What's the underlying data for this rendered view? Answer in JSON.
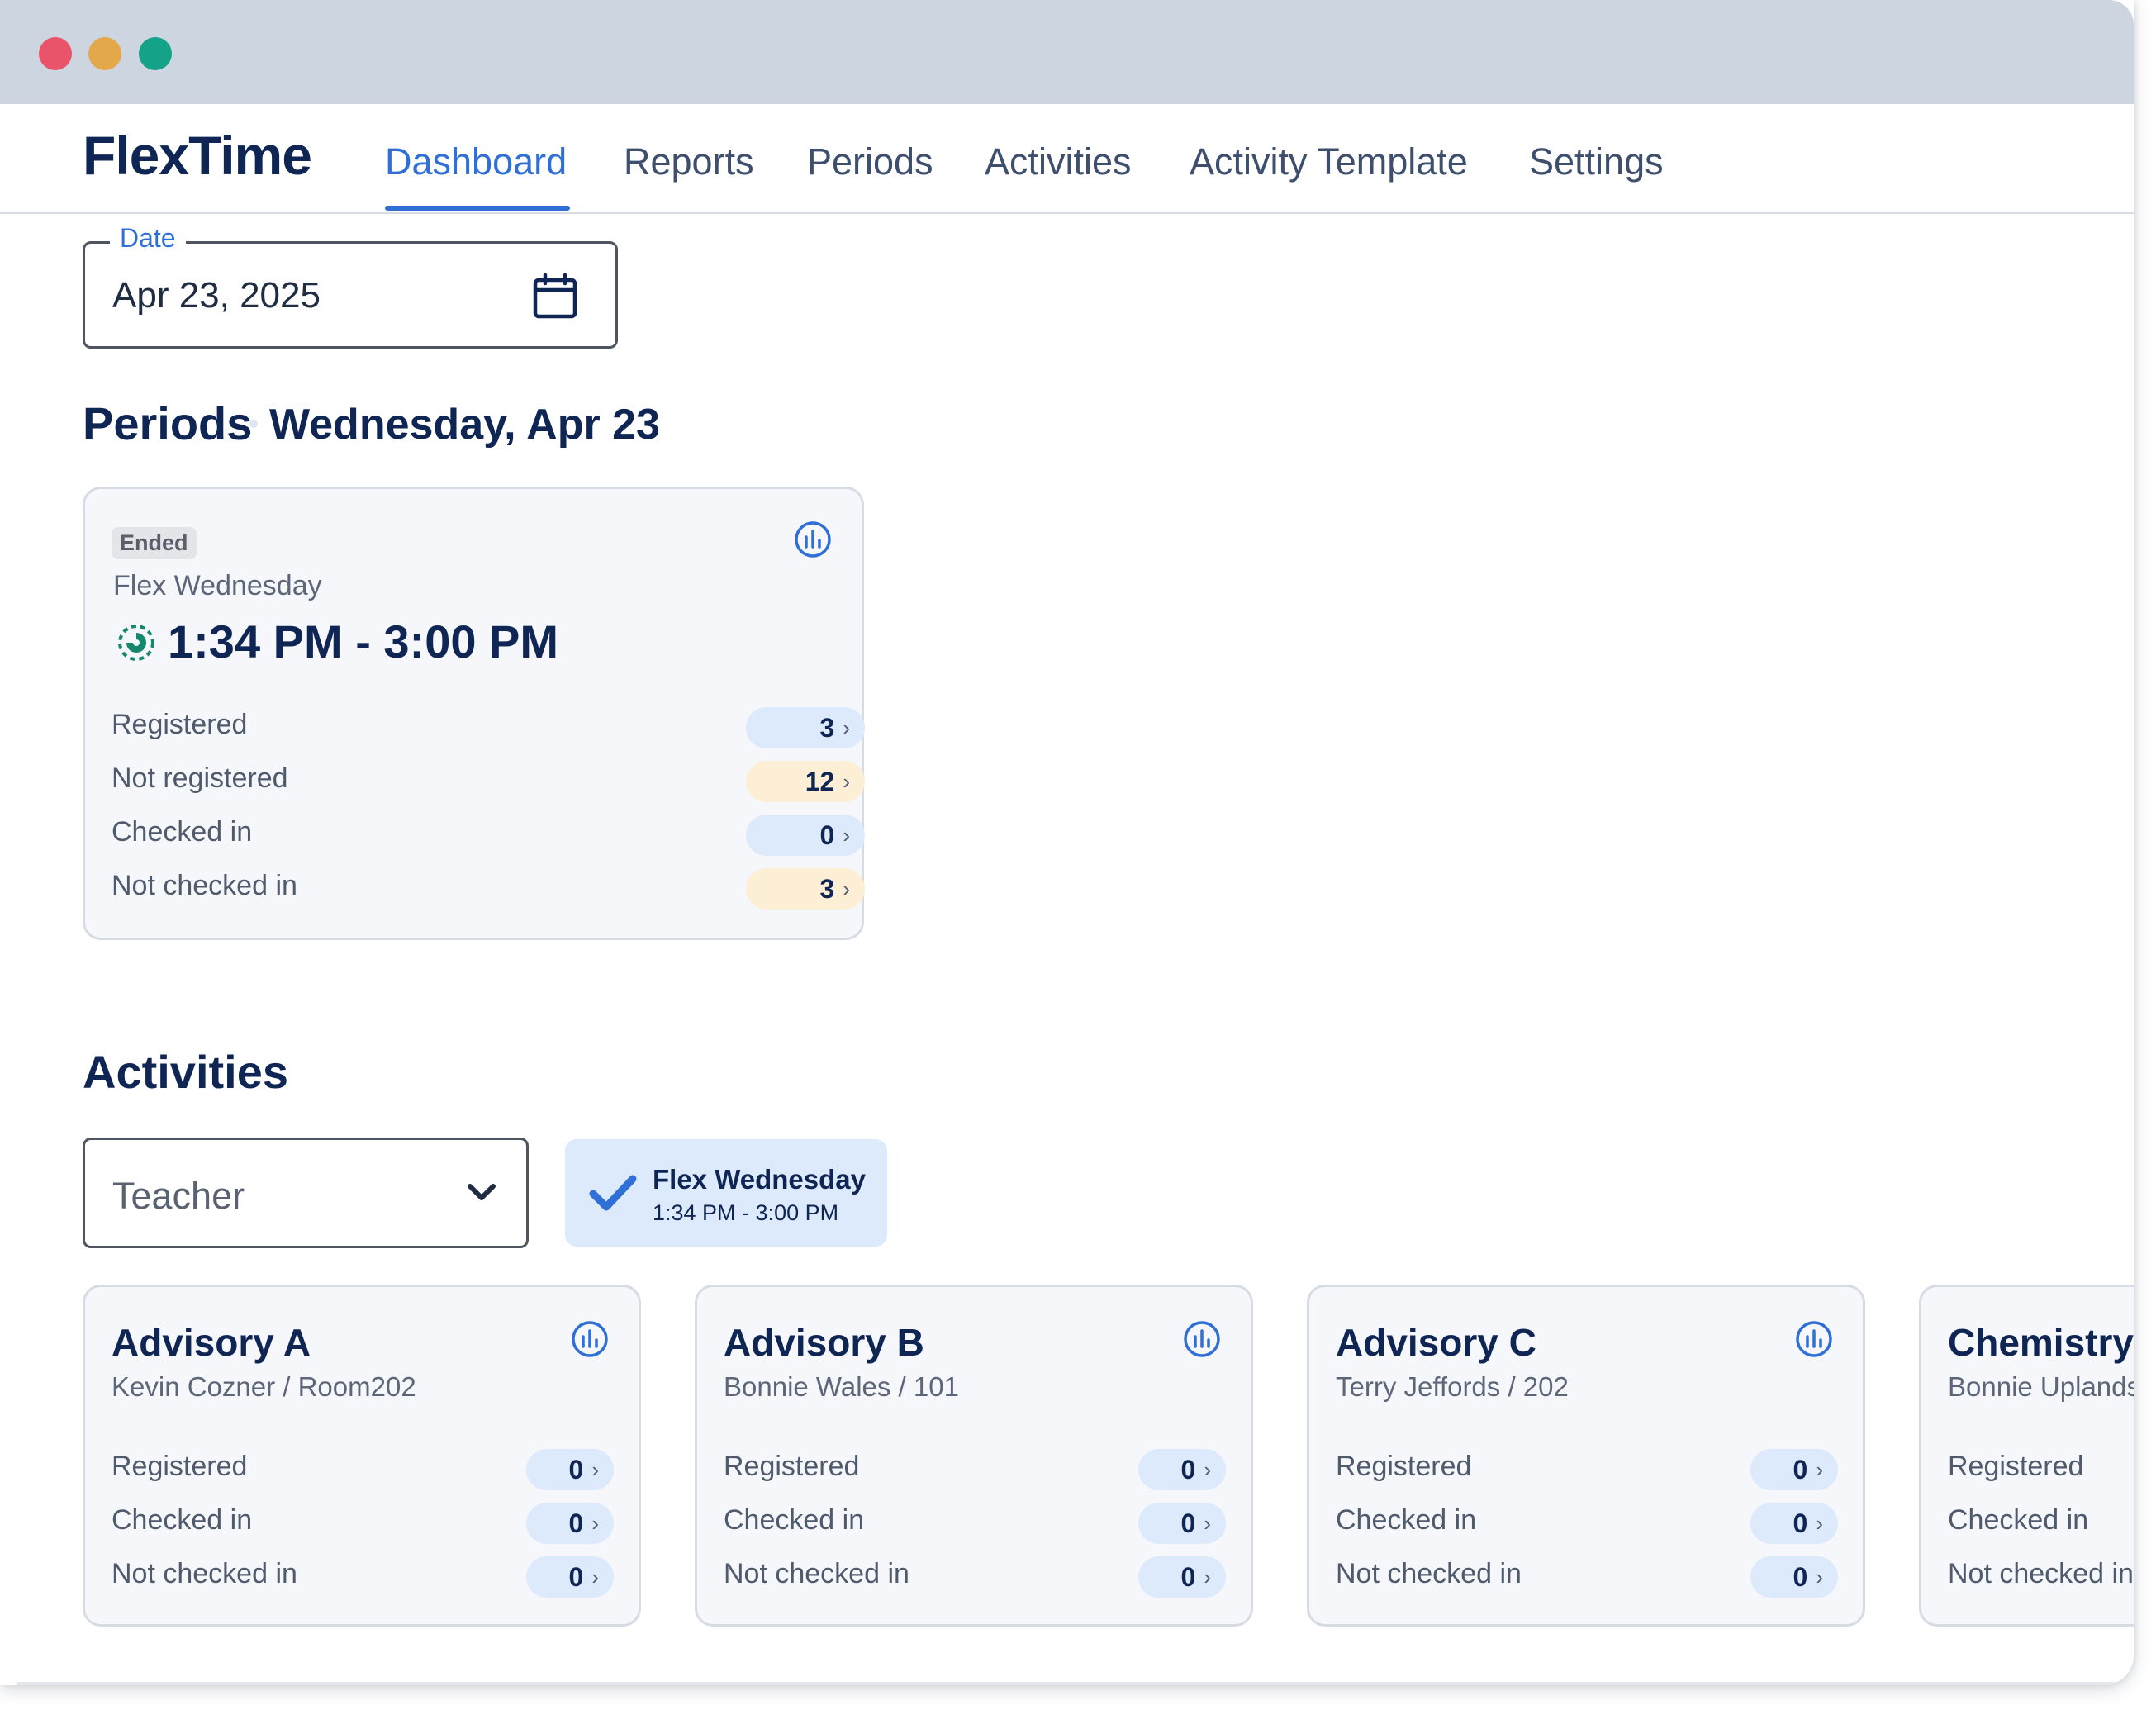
{
  "app": {
    "brand": "FlexTime",
    "nav": [
      "Dashboard",
      "Reports",
      "Periods",
      "Activities",
      "Activity Template",
      "Settings"
    ],
    "active_tab": "Dashboard"
  },
  "date_field": {
    "label": "Date",
    "value": "Apr 23, 2025"
  },
  "periods": {
    "title": "Periods",
    "day": "Wednesday, Apr 23",
    "card": {
      "status": "Ended",
      "name": "Flex Wednesday",
      "time": "1:34 PM - 3:00 PM",
      "stats": [
        {
          "label": "Registered",
          "value": "3",
          "tone": "blue"
        },
        {
          "label": "Not registered",
          "value": "12",
          "tone": "orange"
        },
        {
          "label": "Checked in",
          "value": "0",
          "tone": "blue"
        },
        {
          "label": "Not checked in",
          "value": "3",
          "tone": "orange"
        }
      ]
    }
  },
  "activities": {
    "title": "Activities",
    "teacher_select": {
      "value": "Teacher"
    },
    "period_filter": {
      "title": "Flex Wednesday",
      "time": "1:34 PM - 3:00 PM",
      "checked": true
    },
    "cards": [
      {
        "name": "Advisory A",
        "meta": "Kevin Cozner / Room202",
        "stats": [
          {
            "label": "Registered",
            "value": "0"
          },
          {
            "label": "Checked in",
            "value": "0"
          },
          {
            "label": "Not checked in",
            "value": "0"
          }
        ]
      },
      {
        "name": "Advisory B",
        "meta": "Bonnie Wales / 101",
        "stats": [
          {
            "label": "Registered",
            "value": "0"
          },
          {
            "label": "Checked in",
            "value": "0"
          },
          {
            "label": "Not checked in",
            "value": "0"
          }
        ]
      },
      {
        "name": "Advisory C",
        "meta": "Terry Jeffords / 202",
        "stats": [
          {
            "label": "Registered",
            "value": "0"
          },
          {
            "label": "Checked in",
            "value": "0"
          },
          {
            "label": "Not checked in",
            "value": "0"
          }
        ]
      },
      {
        "name": "Chemistry",
        "meta": "Bonnie Uplands",
        "stats": [
          {
            "label": "Registered",
            "value": ""
          },
          {
            "label": "Checked in",
            "value": ""
          },
          {
            "label": "Not checked in",
            "value": ""
          }
        ]
      }
    ]
  },
  "colors": {
    "accent": "#2f6fd6",
    "brand_text": "#0f2655",
    "pill_blue": "#dceafb",
    "pill_orange": "#fdefd6",
    "titlebar": "#cdd6e0"
  },
  "icons": {
    "calendar": "calendar-icon",
    "chart": "bar-chart-icon",
    "clock": "progress-clock-icon",
    "chevron_down": "chevron-down-icon",
    "check": "check-icon"
  }
}
